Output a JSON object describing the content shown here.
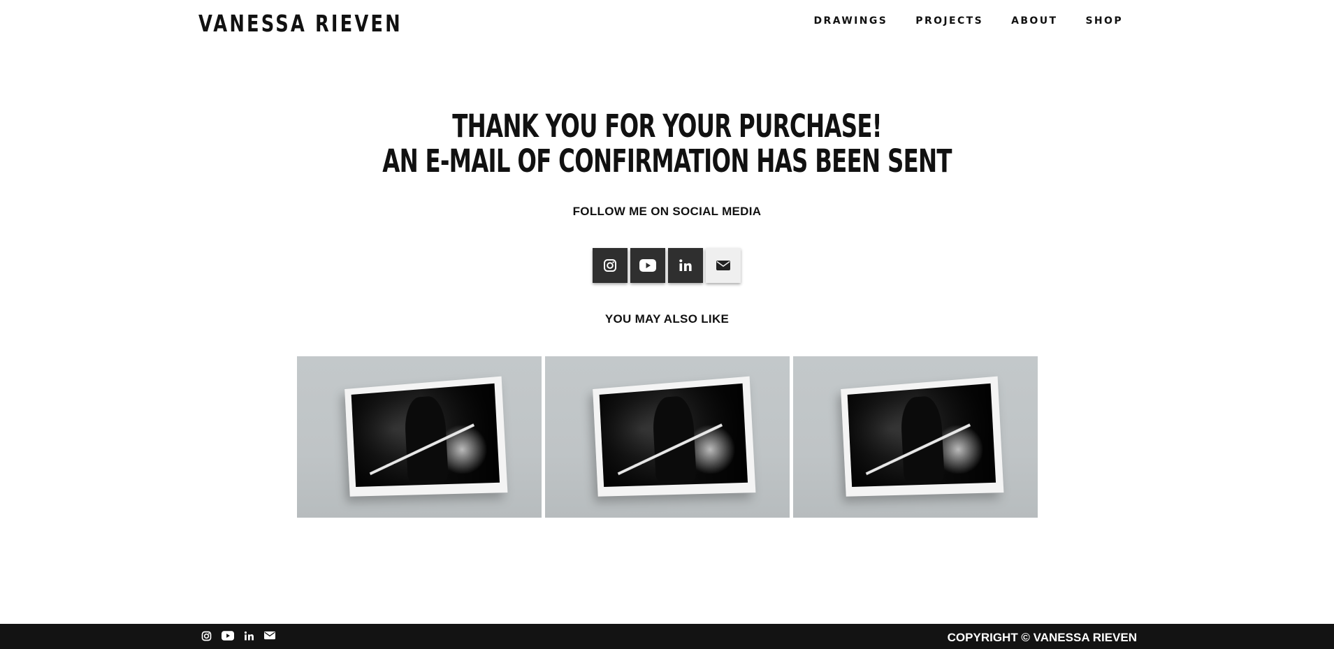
{
  "header": {
    "logo": "VANESSA RIEVEN",
    "nav": [
      "DRAWINGS",
      "PROJECTS",
      "ABOUT",
      "SHOP"
    ]
  },
  "main": {
    "headline_line1": "THANK YOU FOR YOUR PURCHASE!",
    "headline_line2": "AN E-MAIL OF CONFIRMATION HAS BEEN SENT",
    "follow_label": "FOLLOW ME ON SOCIAL MEDIA",
    "social_icons": [
      "instagram-icon",
      "youtube-icon",
      "linkedin-icon",
      "mail-icon"
    ],
    "also_like_label": "YOU MAY ALSO LIKE",
    "products": [
      {
        "image": "framed-print-knight-artwork"
      },
      {
        "image": "framed-print-knight-artwork"
      },
      {
        "image": "framed-print-knight-artwork"
      }
    ]
  },
  "footer": {
    "icons": [
      "instagram-icon",
      "youtube-icon",
      "linkedin-icon",
      "mail-icon"
    ],
    "copyright": "COPYRIGHT © VANESSA RIEVEN"
  },
  "colors": {
    "text": "#111111",
    "button_dark": "#2f2f2f",
    "button_light": "#efefef",
    "footer_bg": "#131313",
    "product_bg": "#c3c8ca"
  }
}
